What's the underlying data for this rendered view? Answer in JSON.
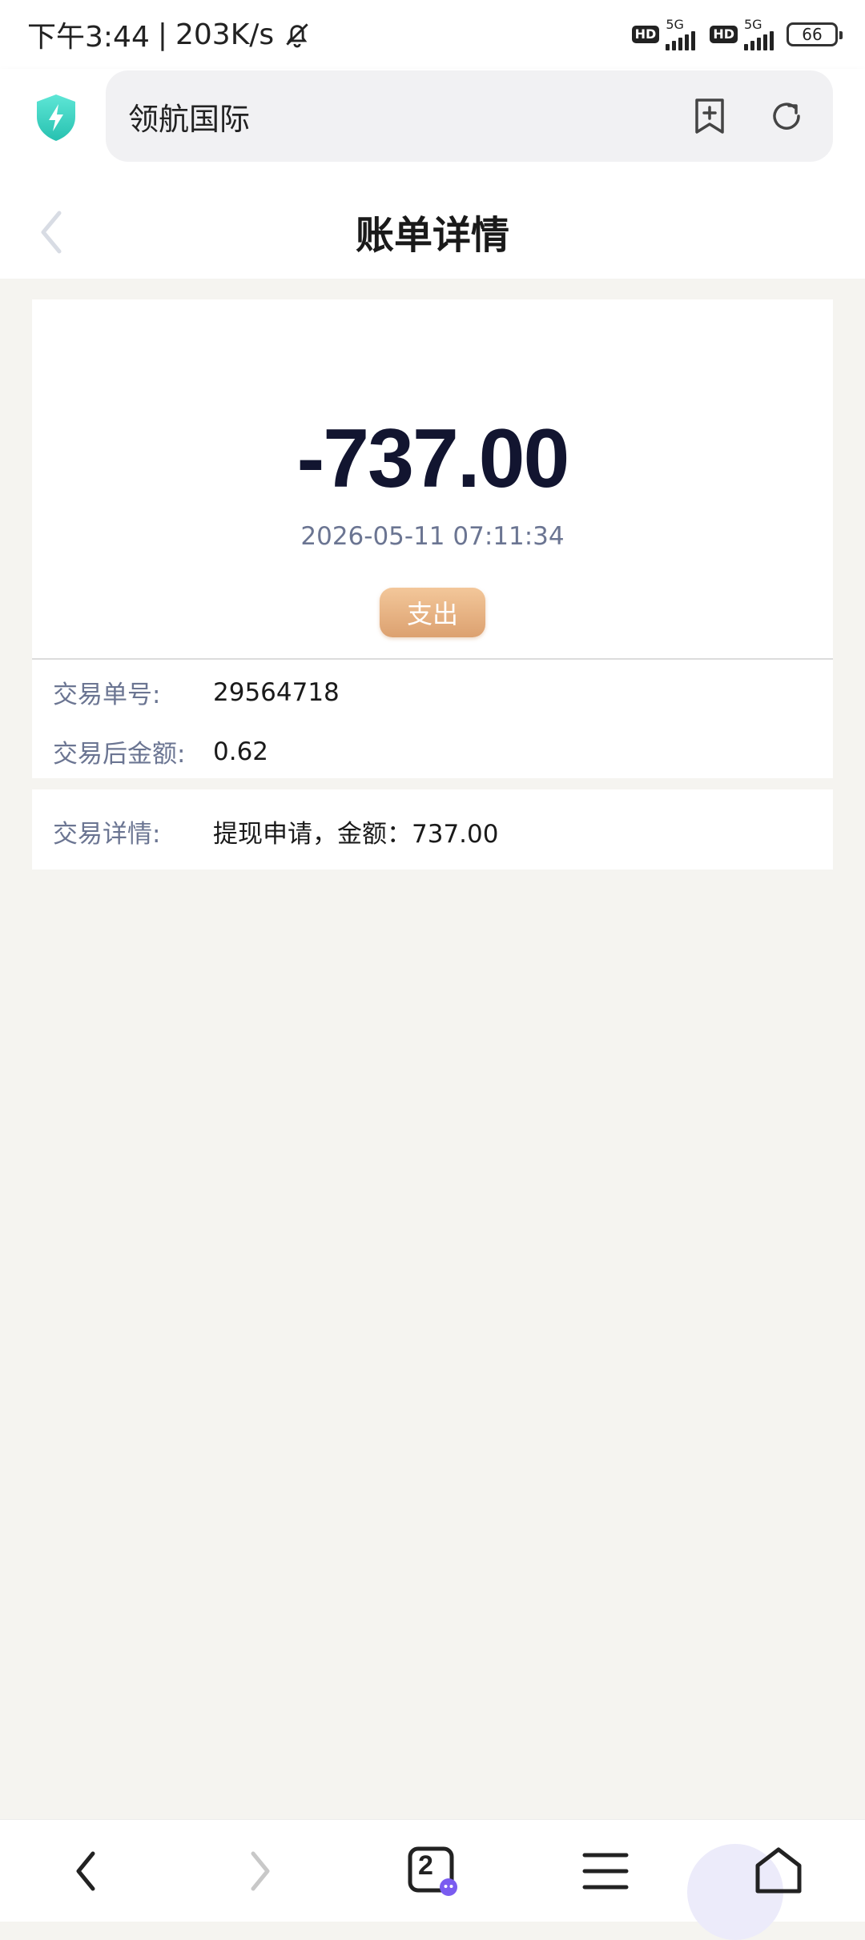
{
  "status_bar": {
    "time": "下午3:44",
    "separator": "|",
    "net_speed": "203K/s",
    "sim1_label": "5G",
    "sim2_label": "5G",
    "hd_label": "HD",
    "battery": "66",
    "icons": [
      "bell-muted-icon",
      "signal-icon",
      "battery-icon"
    ]
  },
  "browser": {
    "site_title": "领航国际",
    "icons": [
      "shield-icon",
      "bookmark-add-icon",
      "refresh-icon"
    ]
  },
  "header": {
    "title": "账单详情",
    "back_icon": "chevron-left-icon"
  },
  "bill": {
    "amount": "-737.00",
    "datetime": "2026-05-11 07:11:34",
    "type": "支出",
    "info_rows": [
      {
        "label": "交易单号:",
        "value": "29564718"
      },
      {
        "label": "交易后金额:",
        "value": "0.62"
      }
    ],
    "detail_row": {
      "label": "交易详情:",
      "value": "提现申请，金额：737.00"
    }
  },
  "bottom_nav": {
    "tab_count": "2",
    "icons": [
      "back-icon",
      "forward-icon",
      "tabs-icon",
      "menu-icon",
      "home-icon"
    ]
  },
  "colors": {
    "amount": "#121530",
    "label": "#6b7592",
    "badge_start": "#f3c79a",
    "badge_end": "#dca170",
    "page_bg": "#f5f4f0",
    "shield": "#3dd6c4"
  }
}
